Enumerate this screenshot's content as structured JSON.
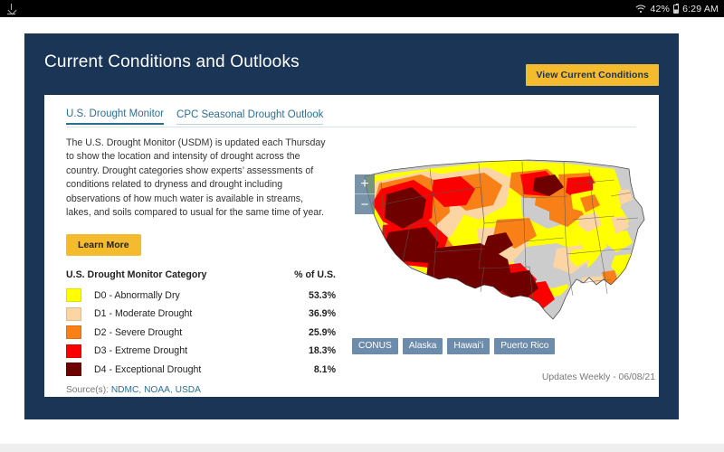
{
  "statusbar": {
    "download_icon": "download-icon",
    "wifi_icon": "wifi-icon",
    "battery_pct": "42%",
    "battery_icon": "battery-icon",
    "time": "6:29 AM"
  },
  "card": {
    "title": "Current Conditions and Outlooks",
    "view_button": "View Current Conditions",
    "accent_gold": "#f5bb2e",
    "navy": "#1b3557"
  },
  "tabs": [
    {
      "label": "U.S. Drought Monitor",
      "active": true
    },
    {
      "label": "CPC Seasonal Drought Outlook",
      "active": false
    }
  ],
  "intro": "The U.S. Drought Monitor (USDM) is updated each Thursday to show the location and intensity of drought across the country. Drought categories show experts’ assessments of conditions related to dryness and drought including observations of how much water is available in streams, lakes, and soils compared to usual for the same time of year.",
  "learn_more": "Learn More",
  "legend": {
    "title": "U.S. Drought Monitor Category",
    "value_header": "% of U.S.",
    "rows": [
      {
        "label": "D0 - Abnormally Dry",
        "pct": "53.3%",
        "color": "#ffff00"
      },
      {
        "label": "D1 - Moderate Drought",
        "pct": "36.9%",
        "color": "#fcd5a4"
      },
      {
        "label": "D2 - Severe Drought",
        "pct": "25.9%",
        "color": "#f88017"
      },
      {
        "label": "D3 - Extreme Drought",
        "pct": "18.3%",
        "color": "#fa0000"
      },
      {
        "label": "D4 - Exceptional Drought",
        "pct": "8.1%",
        "color": "#6f0000"
      }
    ]
  },
  "source": {
    "prefix": "Source(s): ",
    "links": [
      "NDMC",
      "NOAA",
      "USDA"
    ]
  },
  "map": {
    "zoom_in": "+",
    "zoom_out": "−",
    "regions": [
      "CONUS",
      "Alaska",
      "Hawaiʻi",
      "Puerto Rico"
    ],
    "updates": "Updates Weekly  -  06/08/21",
    "base_color": "#cccccc"
  }
}
